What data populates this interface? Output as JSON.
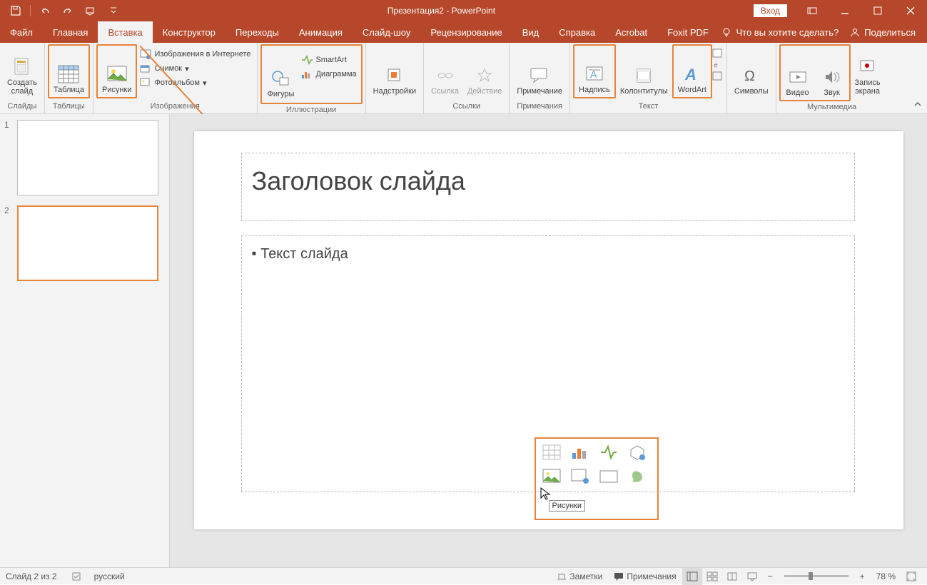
{
  "title": {
    "doc": "Презентация2",
    "app": "PowerPoint",
    "login": "Вход"
  },
  "tabs": {
    "items": [
      "Файл",
      "Главная",
      "Вставка",
      "Конструктор",
      "Переходы",
      "Анимация",
      "Слайд-шоу",
      "Рецензирование",
      "Вид",
      "Справка",
      "Acrobat",
      "Foxit PDF"
    ],
    "active": 2,
    "tell_me": "Что вы хотите сделать?",
    "share": "Поделиться"
  },
  "ribbon": {
    "groups": {
      "slides": {
        "new_slide": "Создать\nслайд",
        "label": "Слайды"
      },
      "tables": {
        "table": "Таблица",
        "label": "Таблицы"
      },
      "images": {
        "pictures": "Рисунки",
        "online": "Изображения в Интернете",
        "screenshot": "Снимок",
        "album": "Фотоальбом",
        "label": "Изображения"
      },
      "illus": {
        "shapes": "Фигуры",
        "smartart": "SmartArt",
        "chart": "Диаграмма",
        "label": "Иллюстрации"
      },
      "addins": {
        "addins": "Надстройки",
        "label": ""
      },
      "links": {
        "link": "Ссылка",
        "action": "Действие",
        "label": "Ссылки"
      },
      "comments": {
        "comment": "Примечание",
        "label": "Примечания"
      },
      "text": {
        "textbox": "Надпись",
        "header": "Колонтитулы",
        "wordart": "WordArt",
        "label": "Текст"
      },
      "symbols": {
        "symbols": "Символы",
        "label": ""
      },
      "media": {
        "video": "Видео",
        "audio": "Звук",
        "record": "Запись\nэкрана",
        "label": "Мультимедиа"
      }
    }
  },
  "thumbs": {
    "items": [
      {
        "n": "1"
      },
      {
        "n": "2"
      }
    ],
    "selected": 1
  },
  "slide": {
    "title_placeholder": "Заголовок слайда",
    "body_placeholder": "Текст слайда",
    "tooltip": "Рисунки"
  },
  "status": {
    "slide_info": "Слайд 2 из 2",
    "lang": "русский",
    "notes": "Заметки",
    "comments": "Примечания",
    "zoom": "78 %"
  }
}
